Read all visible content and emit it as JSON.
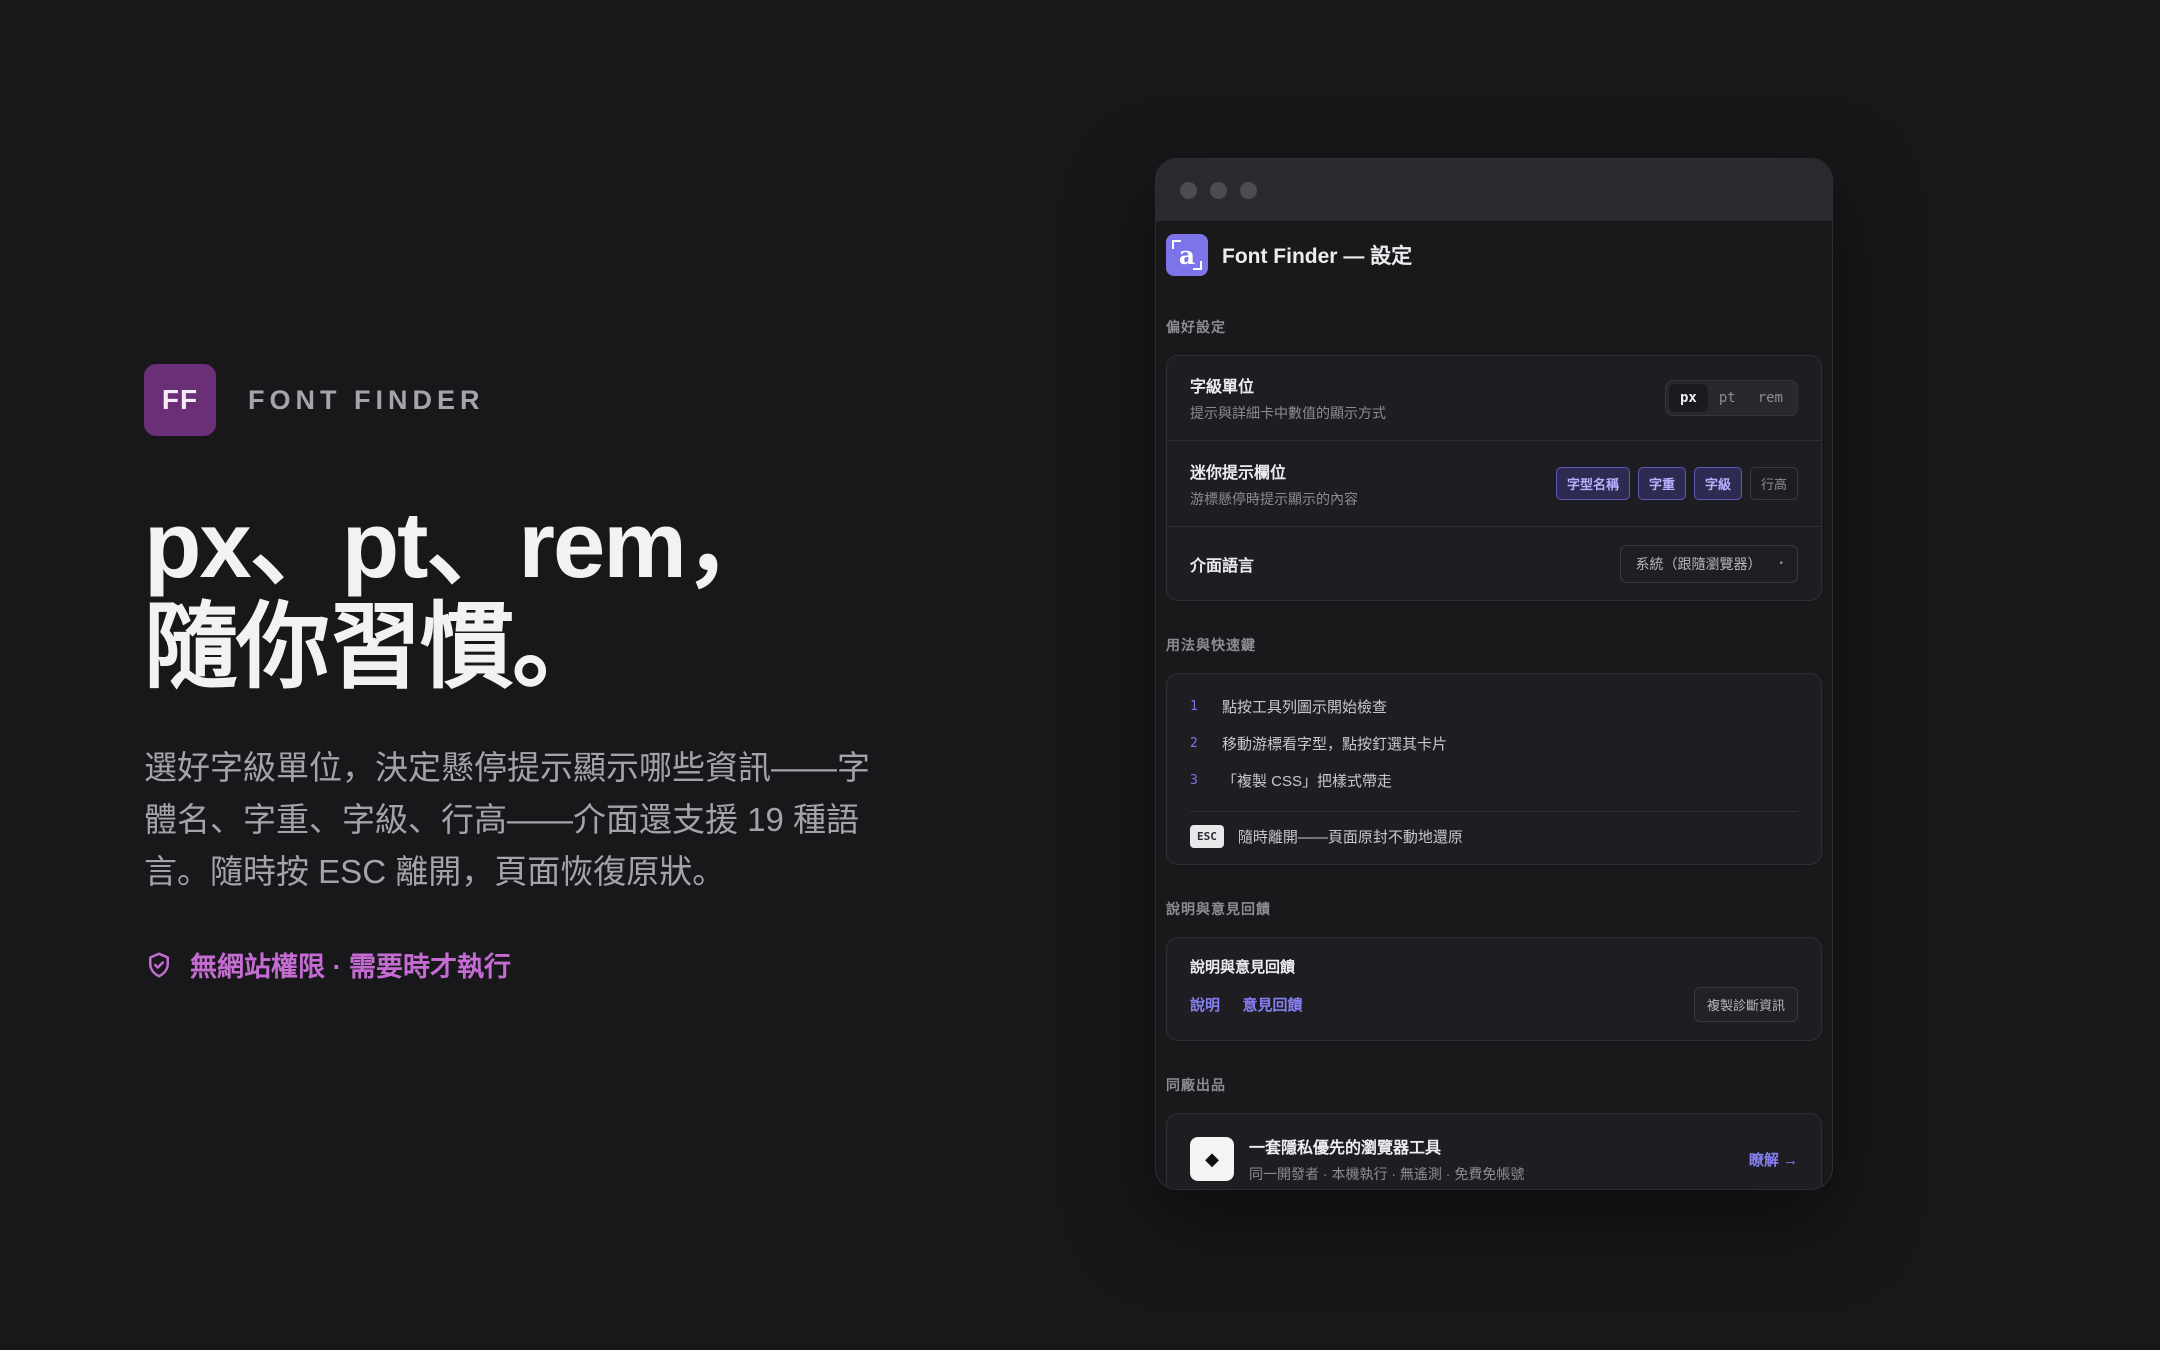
{
  "hero": {
    "logo_text": "FF",
    "brand_name": "FONT FINDER",
    "headline_line1": "px、pt、rem，",
    "headline_line2": "隨你習慣。",
    "subtitle": "選好字級單位，決定懸停提示顯示哪些資訊——字體名、字重、字級、行高——介面還支援 19 種語言。隨時按 ESC 離開，頁面恢復原狀。",
    "note": "無網站權限 · 需要時才執行",
    "accent_color": "#c46cd2"
  },
  "window": {
    "app_icon": "a",
    "app_title": "Font Finder — 設定",
    "sections": {
      "preferences": "偏好設定",
      "usage": "用法與快速鍵",
      "help": "說明與意見回饋",
      "more": "同廠出品"
    },
    "font_unit": {
      "title": "字級單位",
      "desc": "提示與詳細卡中數值的顯示方式",
      "options": [
        "px",
        "pt",
        "rem"
      ],
      "selected": "px"
    },
    "tooltip_fields": {
      "title": "迷你提示欄位",
      "desc": "游標懸停時提示顯示的內容",
      "chips": [
        {
          "label": "字型名稱",
          "on": true
        },
        {
          "label": "字重",
          "on": true
        },
        {
          "label": "字級",
          "on": true
        },
        {
          "label": "行高",
          "on": false
        }
      ]
    },
    "language": {
      "title": "介面語言",
      "value": "系統（跟隨瀏覽器）"
    },
    "steps": [
      {
        "num": "1",
        "text": "點按工具列圖示開始檢查"
      },
      {
        "num": "2",
        "text": "移動游標看字型，點按釘選其卡片"
      },
      {
        "num": "3",
        "text": "「複製 CSS」把樣式帶走"
      }
    ],
    "esc": {
      "key": "ESC",
      "text": "隨時離開——頁面原封不動地還原"
    },
    "help": {
      "title": "說明與意見回饋",
      "link1": "說明",
      "link2": "意見回饋",
      "button": "複製診斷資訊"
    },
    "promo": {
      "icon": "◆",
      "title": "一套隱私優先的瀏覽器工具",
      "desc": "同一開發者 · 本機執行 · 無遙測 · 免費免帳號",
      "link": "瞭解 →"
    },
    "accent_color": "#7c74e8"
  }
}
